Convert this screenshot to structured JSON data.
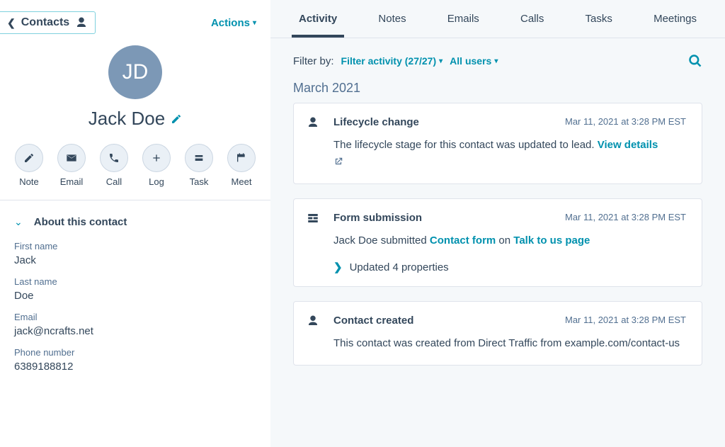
{
  "header": {
    "back_label": "Contacts",
    "actions_label": "Actions"
  },
  "contact": {
    "initials": "JD",
    "full_name": "Jack Doe"
  },
  "hero_actions": [
    {
      "label": "Note"
    },
    {
      "label": "Email"
    },
    {
      "label": "Call"
    },
    {
      "label": "Log"
    },
    {
      "label": "Task"
    },
    {
      "label": "Meet"
    }
  ],
  "about": {
    "section_title": "About this contact",
    "first_name_label": "First name",
    "first_name_value": "Jack",
    "last_name_label": "Last name",
    "last_name_value": "Doe",
    "email_label": "Email",
    "email_value": "jack@ncrafts.net",
    "phone_label": "Phone number",
    "phone_value": "6389188812"
  },
  "tabs": [
    "Activity",
    "Notes",
    "Emails",
    "Calls",
    "Tasks",
    "Meetings"
  ],
  "filter": {
    "label": "Filter by:",
    "activity": "Filter activity (27/27)",
    "users": "All users"
  },
  "timeline": {
    "month": "March 2021",
    "items": [
      {
        "title": "Lifecycle change",
        "date": "Mar 11, 2021 at 3:28 PM EST",
        "body_prefix": "The lifecycle stage for this contact was updated to lead. ",
        "view_details": "View details"
      },
      {
        "title": "Form submission",
        "date": "Mar 11, 2021 at 3:28 PM EST",
        "submitter": "Jack Doe submitted ",
        "form_link": "Contact form",
        "on_text": " on ",
        "page_link": "Talk to us page",
        "expand_text": "Updated 4 properties"
      },
      {
        "title": "Contact created",
        "date": "Mar 11, 2021 at 3:28 PM EST",
        "body": "This contact was created from Direct Traffic from example.com/contact-us"
      }
    ]
  }
}
